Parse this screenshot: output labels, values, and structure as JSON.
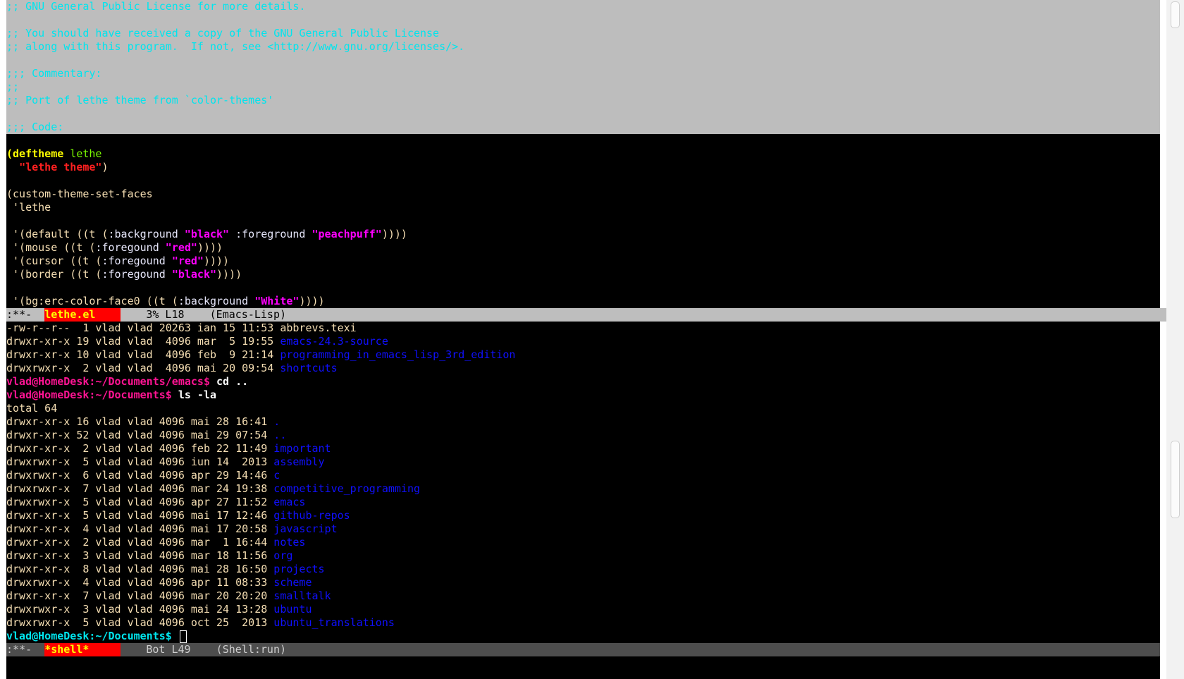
{
  "top_buffer": {
    "region_lines": [
      ";; GNU General Public License for more details.",
      "",
      ";; You should have received a copy of the GNU General Public License",
      ";; along with this program.  If not, see <http://www.gnu.org/licenses/>.",
      "",
      ";;; Commentary:",
      ";;",
      ";; Port of lethe theme from `color-themes'",
      "",
      ";;; Code:"
    ],
    "code": {
      "paren_open": "(",
      "deftheme": "deftheme",
      "theme_name": "lethe",
      "theme_doc": "\"lethe theme\"",
      "paren_close": ")",
      "set_faces": "(custom-theme-set-faces",
      "set_faces_arg": " 'lethe",
      "default_pre": " '(default ((t (",
      "default_kw1": ":background",
      "default_v1": "\"black\"",
      "default_kw2": ":foreground",
      "default_v2": "\"peachpuff\"",
      "default_post": "))))",
      "mouse_pre": " '(mouse ((t (",
      "mouse_kw": ":foregound",
      "mouse_v": "\"red\"",
      "mouse_post": "))))",
      "cursor_pre": " '(cursor ((t (",
      "cursor_kw": ":foregound",
      "cursor_v": "\"red\"",
      "cursor_post": "))))",
      "border_pre": " '(border ((t (",
      "border_kw": ":foregound",
      "border_v": "\"black\"",
      "border_post": "))))",
      "erc_pre": " '(bg:erc-color-face0 ((t (",
      "erc_kw": ":background",
      "erc_v": "\"White\"",
      "erc_post": "))))"
    }
  },
  "modeline_top": {
    "status": "U:**-  ",
    "buffer": "lethe.el",
    "position": "    3% L18",
    "mode": "    (Emacs-Lisp)"
  },
  "shell": {
    "pre_listing": [
      {
        "meta": "-rw-r--r--  1 vlad vlad 20263 ian 15 11:53 ",
        "name": "abbrevs.texi",
        "dir": false
      },
      {
        "meta": "drwxr-xr-x 19 vlad vlad  4096 mar  5 19:55 ",
        "name": "emacs-24.3-source",
        "dir": true
      },
      {
        "meta": "drwxr-xr-x 10 vlad vlad  4096 feb  9 21:14 ",
        "name": "programming_in_emacs_lisp_3rd_edition",
        "dir": true
      },
      {
        "meta": "drwxrwxr-x  2 vlad vlad  4096 mai 20 09:54 ",
        "name": "shortcuts",
        "dir": true
      }
    ],
    "prompt1": "vlad@HomeDesk:~/Documents/emacs$",
    "cmd1": " cd ..",
    "prompt2": "vlad@HomeDesk:~/Documents$",
    "cmd2": " ls -la",
    "total": "total 64",
    "listing": [
      {
        "meta": "drwxr-xr-x 16 vlad vlad 4096 mai 28 16:41 ",
        "name": "."
      },
      {
        "meta": "drwxr-xr-x 52 vlad vlad 4096 mai 29 07:54 ",
        "name": ".."
      },
      {
        "meta": "drwxr-xr-x  2 vlad vlad 4096 feb 22 11:49 ",
        "name": "important"
      },
      {
        "meta": "drwxrwxr-x  5 vlad vlad 4096 iun 14  2013 ",
        "name": "assembly"
      },
      {
        "meta": "drwxrwxr-x  6 vlad vlad 4096 apr 29 14:46 ",
        "name": "c"
      },
      {
        "meta": "drwxrwxr-x  7 vlad vlad 4096 mar 24 19:38 ",
        "name": "competitive_programming"
      },
      {
        "meta": "drwxrwxr-x  5 vlad vlad 4096 apr 27 11:52 ",
        "name": "emacs"
      },
      {
        "meta": "drwxr-xr-x  5 vlad vlad 4096 mai 17 12:46 ",
        "name": "github-repos"
      },
      {
        "meta": "drwxr-xr-x  4 vlad vlad 4096 mai 17 20:58 ",
        "name": "javascript"
      },
      {
        "meta": "drwxr-xr-x  2 vlad vlad 4096 mar  1 16:44 ",
        "name": "notes"
      },
      {
        "meta": "drwxr-xr-x  3 vlad vlad 4096 mar 18 11:56 ",
        "name": "org"
      },
      {
        "meta": "drwxr-xr-x  8 vlad vlad 4096 mai 28 16:50 ",
        "name": "projects"
      },
      {
        "meta": "drwxrwxr-x  4 vlad vlad 4096 apr 11 08:33 ",
        "name": "scheme"
      },
      {
        "meta": "drwxr-xr-x  7 vlad vlad 4096 mar 20 20:20 ",
        "name": "smalltalk"
      },
      {
        "meta": "drwxrwxr-x  3 vlad vlad 4096 mai 24 13:28 ",
        "name": "ubuntu"
      },
      {
        "meta": "drwxrwxr-x  5 vlad vlad 4096 oct 25  2013 ",
        "name": "ubuntu_translations"
      }
    ],
    "prompt3": "vlad@HomeDesk:~/Documents$"
  },
  "modeline_bottom": {
    "status": "U:**-  ",
    "buffer": "*shell*",
    "position": "    Bot L49",
    "mode": "    (Shell:run)"
  },
  "colors": {
    "background": "#000000",
    "foreground": "#f5deb3",
    "comment": "#00e5ee",
    "directory": "#1010ff",
    "modeline_buffer_bg": "#ff0000"
  }
}
